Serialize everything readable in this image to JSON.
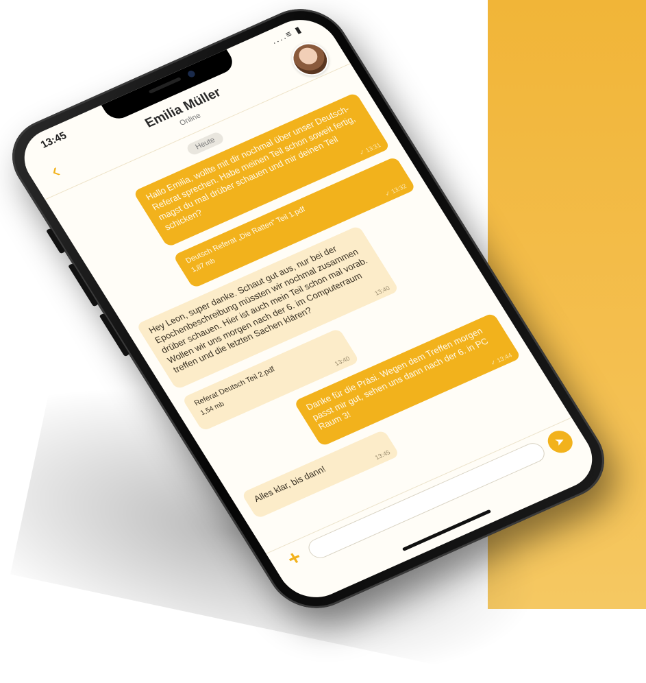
{
  "status_bar": {
    "time": "13:45",
    "icons": "....≡ ▮"
  },
  "header": {
    "back_icon": "chevron-left-icon",
    "contact_name": "Emilia Müller",
    "contact_status": "Online"
  },
  "chat": {
    "date_label": "Heute",
    "messages": [
      {
        "direction": "out",
        "kind": "text",
        "text": "Hallo Emilia, wollte mit dir nochmal über unser Deutsch-Referat sprechen. Habe meinen Teil schon soweit fertig, magst du mal drüber schauen und mir deinen Teil schicken?",
        "time": "13:31",
        "check": "✓"
      },
      {
        "direction": "out",
        "kind": "file",
        "text": "Deutsch Referat „Die Ratten\" Teil 1.pdf",
        "size": "1,87 mb",
        "time": "13:32",
        "check": "✓"
      },
      {
        "direction": "in",
        "kind": "text",
        "text": "Hey Leon, super danke. Schaut gut aus, nur bei der Epochenbeschreibung müssten wir nochmal zusammen drüber schauen. Hier ist auch mein Teil schon mal vorab. Wollen wir uns morgen nach der 6. im Computerraum treffen und die letzten Sachen klären?",
        "time": "13:40"
      },
      {
        "direction": "in",
        "kind": "file",
        "text": "Referat Deutsch Teil 2.pdf",
        "size": "1,54 mb",
        "time": "13:40"
      },
      {
        "direction": "out",
        "kind": "text",
        "text": "Danke für die Präsi. Wegen dem Treffen morgen passt mir gut, sehen uns dann nach der 6. in PC Raum 3!",
        "time": "13:44",
        "check": "✓"
      },
      {
        "direction": "in",
        "kind": "text",
        "text": "Alles klar, bis dann!",
        "time": "13:45"
      }
    ]
  },
  "input_bar": {
    "plus_label": "+",
    "input_value": "",
    "send_icon": "send-icon"
  },
  "colors": {
    "accent": "#f2b21c",
    "background_panel": "#f1b538",
    "incoming_bubble": "#fcecc9"
  }
}
